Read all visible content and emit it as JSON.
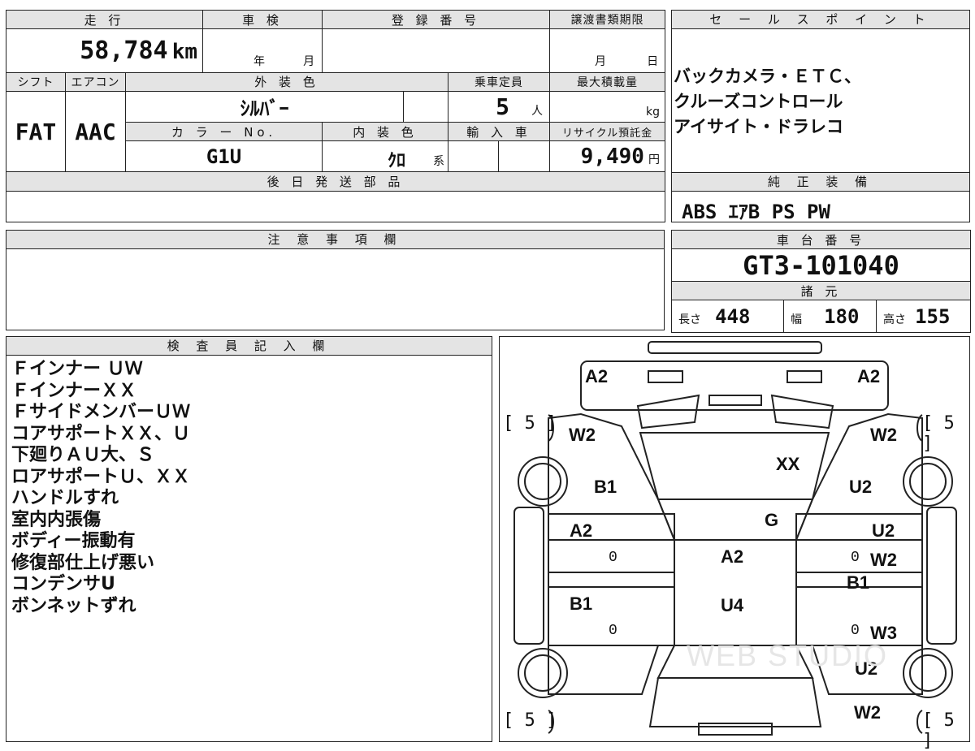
{
  "top": {
    "mileage_label": "走 行",
    "mileage_value": "58,784",
    "mileage_unit": "km",
    "inspection_label": "車 検",
    "inspection_year": "年",
    "inspection_month": "月",
    "registration_label": "登 録 番 号",
    "transfer_deadline_label": "譲渡書類期限",
    "transfer_month": "月",
    "transfer_day": "日",
    "shift_label": "シフト",
    "shift_value": "FAT",
    "aircon_label": "エアコン",
    "aircon_value": "AAC",
    "exterior_color_label": "外 装 色",
    "exterior_color_value": "ｼﾙﾊﾞｰ",
    "capacity_label": "乗車定員",
    "capacity_value": "5",
    "capacity_unit": "人",
    "max_load_label": "最大積載量",
    "max_load_unit": "kg",
    "color_no_label": "カ ラ ー No.",
    "color_no_value": "G1U",
    "interior_color_label": "内 装 色",
    "interior_color_value": "ｸﾛ",
    "interior_color_suffix": "系",
    "import_label": "輸 入 車",
    "recycle_label": "リサイクル預託金",
    "recycle_value": "9,490",
    "recycle_unit": "円",
    "later_parts_label": "後 日 発 送 部 品"
  },
  "sales": {
    "label": "セ ー ル ス ポ イ ン ト",
    "lines": [
      "バックカメラ・ＥＴＣ、",
      "クルーズコントロール",
      "アイサイト・ドラレコ"
    ]
  },
  "equipment": {
    "label": "純 正 装 備",
    "value": "ABS ｴｱB PS PW"
  },
  "notes": {
    "label": "注 意 事 項 欄"
  },
  "chassis": {
    "label": "車 台 番 号",
    "value": "GT3-101040",
    "dims_label": "諸 元",
    "length_label": "長さ",
    "length_value": "448",
    "width_label": "幅",
    "width_value": "180",
    "height_label": "高さ",
    "height_value": "155"
  },
  "inspector": {
    "label": "検 査 員 記 入 欄",
    "lines": [
      "Ｆインナー ＵＷ",
      "ＦインナーＸＸ",
      "ＦサイドメンバーＵＷ",
      "コアサポートＸＸ、Ｕ",
      "下廻りＡＵ大、Ｓ",
      "ロアサポートＵ、ＸＸ",
      "ハンドルすれ",
      "室内内張傷",
      "ボディー振動有",
      "修復部仕上げ悪い",
      "コンデンサU",
      "ボンネットずれ"
    ]
  },
  "diagram": {
    "front_left": "A2",
    "front_right": "A2",
    "tire_tl": "[ 5 ]",
    "tire_tr": "[ 5 ]",
    "tire_bl": "[ 5 ]",
    "tire_br": "[ 5 ]",
    "fender_fl": "W2",
    "fender_fr": "W2",
    "hood": "XX",
    "fender_fl2": "B1",
    "fender_fr2": "U2",
    "windshield": "G",
    "door_fl": "A2",
    "door_fr": "U2",
    "door_fr2": "W2",
    "door_fr3": "B1",
    "roof": "A2",
    "door_rl": "B1",
    "door_rr": "W3",
    "rear": "U4",
    "quarter_r": "U2",
    "quarter_r2": "W2",
    "mark_0a": "0",
    "mark_0b": "0",
    "mark_0c": "0",
    "mark_0d": "0",
    "watermark": "WEB STUDIO"
  }
}
